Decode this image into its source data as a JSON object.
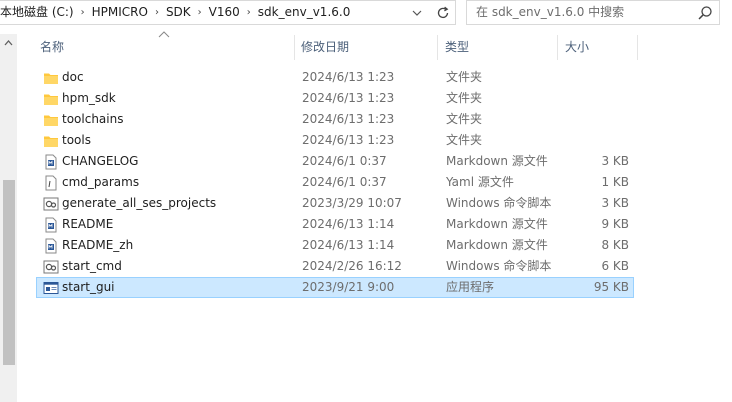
{
  "address_bar": {
    "crumbs": [
      "本地磁盘 (C:)",
      "HPMICRO",
      "SDK",
      "V160",
      "sdk_env_v1.6.0"
    ]
  },
  "search": {
    "placeholder": "在 sdk_env_v1.6.0 中搜索"
  },
  "columns": {
    "name": "名称",
    "date": "修改日期",
    "type": "类型",
    "size": "大小"
  },
  "files": [
    {
      "name": "doc",
      "date": "2024/6/13 1:23",
      "type": "文件夹",
      "size": "",
      "icon": "folder-icon"
    },
    {
      "name": "hpm_sdk",
      "date": "2024/6/13 1:23",
      "type": "文件夹",
      "size": "",
      "icon": "folder-icon"
    },
    {
      "name": "toolchains",
      "date": "2024/6/13 1:23",
      "type": "文件夹",
      "size": "",
      "icon": "folder-icon"
    },
    {
      "name": "tools",
      "date": "2024/6/13 1:23",
      "type": "文件夹",
      "size": "",
      "icon": "folder-icon"
    },
    {
      "name": "CHANGELOG",
      "date": "2024/6/1 0:37",
      "type": "Markdown 源文件",
      "size": "3 KB",
      "icon": "markdown-file-icon"
    },
    {
      "name": "cmd_params",
      "date": "2024/6/1 0:37",
      "type": "Yaml 源文件",
      "size": "1 KB",
      "icon": "yaml-file-icon"
    },
    {
      "name": "generate_all_ses_projects",
      "date": "2023/3/29 10:07",
      "type": "Windows 命令脚本",
      "size": "3 KB",
      "icon": "script-file-icon"
    },
    {
      "name": "README",
      "date": "2024/6/13 1:14",
      "type": "Markdown 源文件",
      "size": "9 KB",
      "icon": "markdown-file-icon"
    },
    {
      "name": "README_zh",
      "date": "2024/6/13 1:14",
      "type": "Markdown 源文件",
      "size": "8 KB",
      "icon": "markdown-file-icon"
    },
    {
      "name": "start_cmd",
      "date": "2024/2/26 16:12",
      "type": "Windows 命令脚本",
      "size": "6 KB",
      "icon": "script-file-icon"
    },
    {
      "name": "start_gui",
      "date": "2023/9/21 9:00",
      "type": "应用程序",
      "size": "95 KB",
      "icon": "application-icon",
      "selected": true
    }
  ],
  "colors": {
    "selection_bg": "#cce8ff",
    "selection_border": "#99d1ff",
    "folder": "#ffc83d",
    "header_text": "#4c607a"
  }
}
